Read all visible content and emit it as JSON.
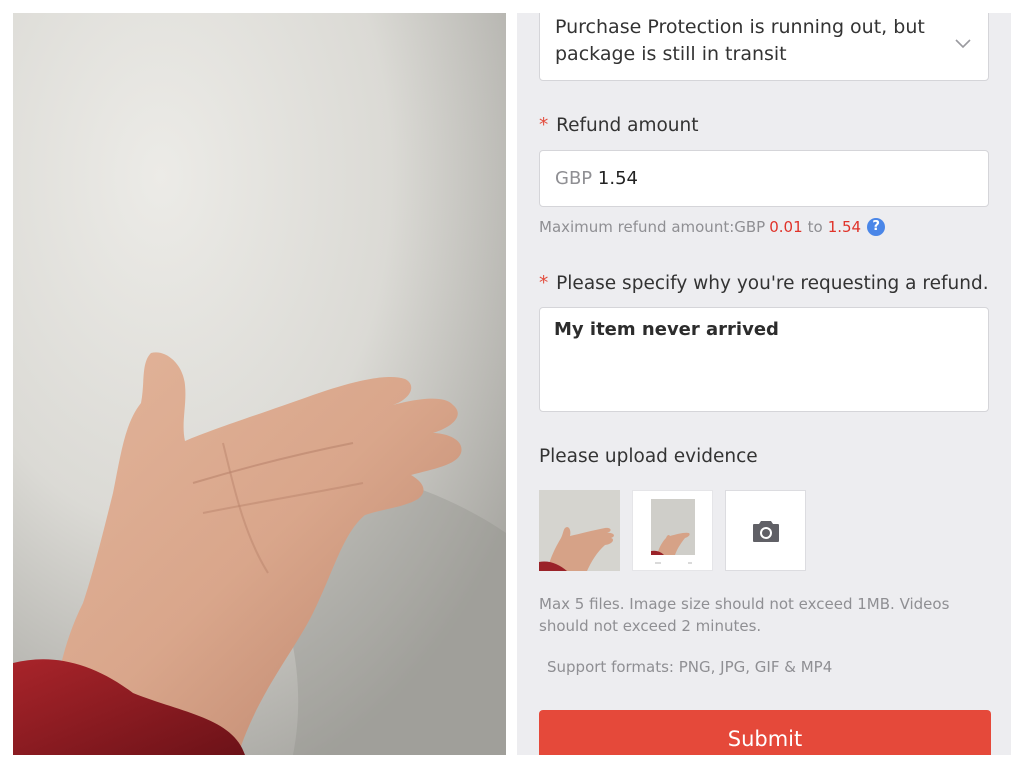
{
  "form": {
    "reason_select": {
      "value": "Purchase Protection is running out, but package is still in transit",
      "chevron_icon": "chevron-down-icon"
    },
    "refund_amount": {
      "required_mark": "*",
      "label": "Refund amount",
      "currency": "GBP",
      "value": "1.54"
    },
    "max_refund": {
      "prefix": "Maximum refund amount:GBP",
      "min": "0.01",
      "separator": "to",
      "max": "1.54",
      "help_icon": "help-icon",
      "help_glyph": "?"
    },
    "reason": {
      "required_mark": "*",
      "label": "Please specify why you're requesting a refund.",
      "value": "My item never arrived"
    },
    "evidence": {
      "label": "Please upload evidence",
      "add_icon": "camera-icon",
      "limits_note": "Max 5 files. Image size should not exceed 1MB. Videos should not exceed 2 minutes.",
      "formats_note": "Support formats: PNG, JPG, GIF & MP4"
    },
    "submit_label": "Submit"
  },
  "colors": {
    "accent_red": "#e5493a",
    "required_red": "#e34b3c",
    "help_blue": "#4a86e8",
    "panel_bg": "#ededf0"
  }
}
